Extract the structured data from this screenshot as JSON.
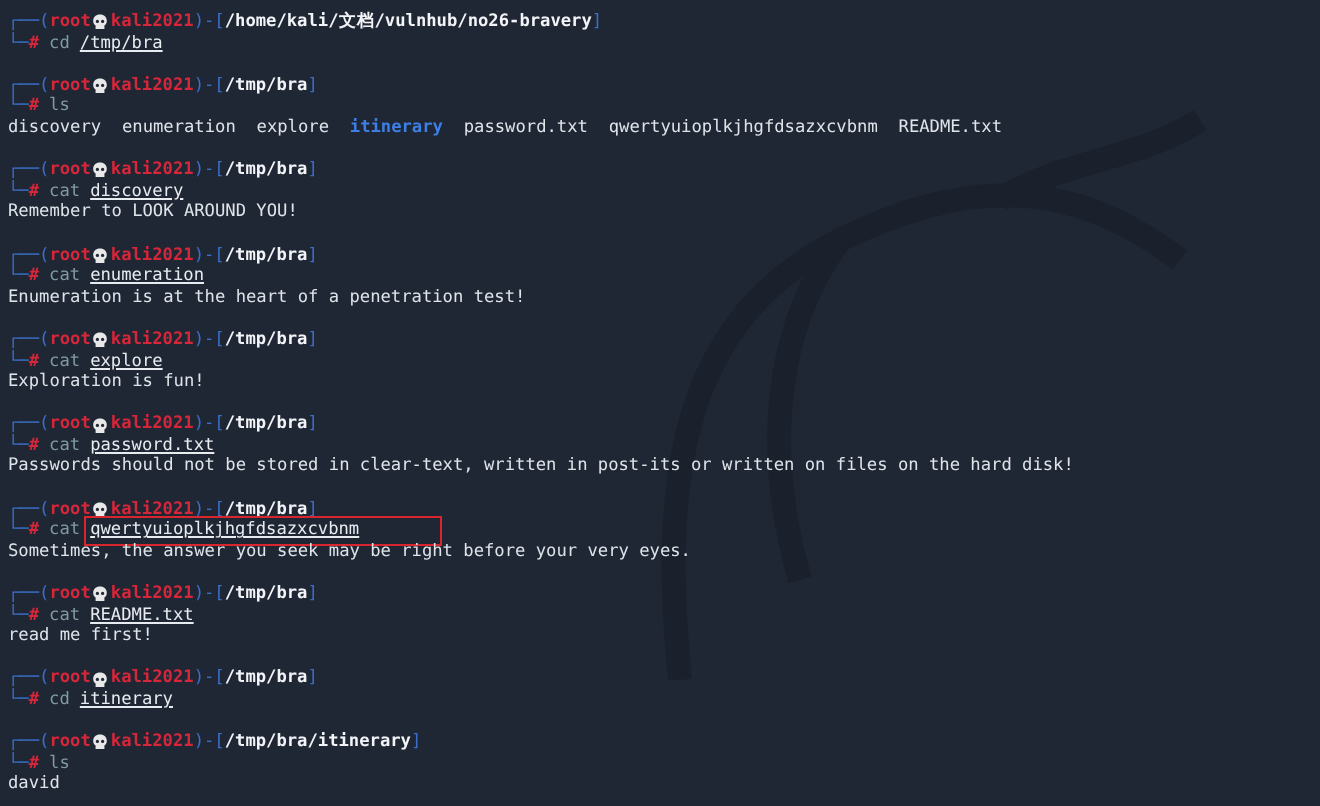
{
  "terminal": {
    "blocks": [
      {
        "prompt": {
          "lead": "┌──(",
          "user": "root",
          "host": "kali2021",
          "mid": ")-[",
          "path": "/home/kali/文档/vulnhub/no26-bravery",
          "close": "]",
          "lead2": "└─",
          "symbol": "#"
        },
        "command": "cd",
        "argument": "/tmp/bra"
      },
      {
        "prompt": {
          "lead": "┌──(",
          "user": "root",
          "host": "kali2021",
          "mid": ")-[",
          "path": "/tmp/bra",
          "close": "]",
          "lead2": "└─",
          "symbol": "#"
        },
        "command": "ls",
        "listing": [
          {
            "name": "discovery",
            "kind": "file"
          },
          {
            "name": "enumeration",
            "kind": "file"
          },
          {
            "name": "explore",
            "kind": "file"
          },
          {
            "name": "itinerary",
            "kind": "dir"
          },
          {
            "name": "password.txt",
            "kind": "file"
          },
          {
            "name": "qwertyuioplkjhgfdsazxcvbnm",
            "kind": "file"
          },
          {
            "name": "README.txt",
            "kind": "file"
          }
        ]
      },
      {
        "prompt": {
          "lead": "┌──(",
          "user": "root",
          "host": "kali2021",
          "mid": ")-[",
          "path": "/tmp/bra",
          "close": "]",
          "lead2": "└─",
          "symbol": "#"
        },
        "command": "cat",
        "argument": "discovery",
        "output": [
          "Remember to LOOK AROUND YOU!"
        ]
      },
      {
        "prompt": {
          "lead": "┌──(",
          "user": "root",
          "host": "kali2021",
          "mid": ")-[",
          "path": "/tmp/bra",
          "close": "]",
          "lead2": "└─",
          "symbol": "#"
        },
        "command": "cat",
        "argument": "enumeration",
        "output": [
          "Enumeration is at the heart of a penetration test!"
        ]
      },
      {
        "prompt": {
          "lead": "┌──(",
          "user": "root",
          "host": "kali2021",
          "mid": ")-[",
          "path": "/tmp/bra",
          "close": "]",
          "lead2": "└─",
          "symbol": "#"
        },
        "command": "cat",
        "argument": "explore",
        "output": [
          "Exploration is fun!"
        ]
      },
      {
        "prompt": {
          "lead": "┌──(",
          "user": "root",
          "host": "kali2021",
          "mid": ")-[",
          "path": "/tmp/bra",
          "close": "]",
          "lead2": "└─",
          "symbol": "#"
        },
        "command": "cat",
        "argument": "password.txt",
        "output": [
          "Passwords should not be stored in clear-text, written in post-its or written on files on the hard disk!"
        ]
      },
      {
        "prompt": {
          "lead": "┌──(",
          "user": "root",
          "host": "kali2021",
          "mid": ")-[",
          "path": "/tmp/bra",
          "close": "]",
          "lead2": "└─",
          "symbol": "#"
        },
        "command": "cat",
        "argument": "qwertyuioplkjhgfdsazxcvbnm",
        "highlighted": true,
        "output": [
          "Sometimes, the answer you seek may be right before your very eyes."
        ]
      },
      {
        "prompt": {
          "lead": "┌──(",
          "user": "root",
          "host": "kali2021",
          "mid": ")-[",
          "path": "/tmp/bra",
          "close": "]",
          "lead2": "└─",
          "symbol": "#"
        },
        "command": "cat",
        "argument": "README.txt",
        "output": [
          "read me first!"
        ]
      },
      {
        "prompt": {
          "lead": "┌──(",
          "user": "root",
          "host": "kali2021",
          "mid": ")-[",
          "path": "/tmp/bra",
          "close": "]",
          "lead2": "└─",
          "symbol": "#"
        },
        "command": "cd",
        "argument": "itinerary"
      },
      {
        "prompt": {
          "lead": "┌──(",
          "user": "root",
          "host": "kali2021",
          "mid": ")-[",
          "path": "/tmp/bra/itinerary",
          "close": "]",
          "lead2": "└─",
          "symbol": "#"
        },
        "command": "ls",
        "listing": [
          {
            "name": "david",
            "kind": "file"
          }
        ]
      }
    ]
  }
}
